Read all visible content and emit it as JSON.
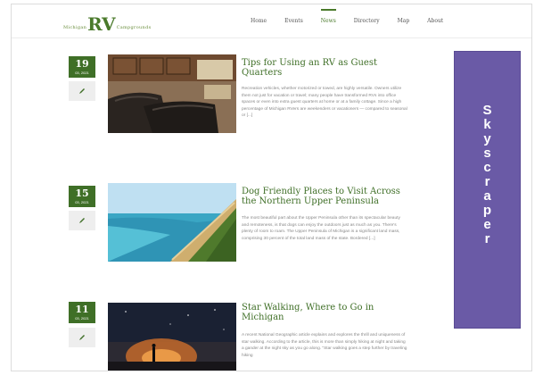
{
  "logo": {
    "left_text": "Michigan",
    "big_text": "RV",
    "right_text": "Campgrounds"
  },
  "nav": {
    "items": [
      "Home",
      "Events",
      "News",
      "Directory",
      "Map",
      "About"
    ],
    "active_index": 2
  },
  "posts": [
    {
      "day": "19",
      "month": "03, 2021",
      "title": "Tips for Using an RV as Guest Quarters",
      "excerpt": "Recreation vehicles, whether motorized or towed, are highly versatile. Owners utilize them not just for vacation or travel; many people have transformed RVs into office spaces or even into extra guest quarters at home or at a family cottage. Since a high percentage of Michigan RVers are weekenders or vacationers — compared to seasonal or [...]"
    },
    {
      "day": "15",
      "month": "03, 2021",
      "title": "Dog Friendly Places to Visit Across the Northern Upper Peninsula",
      "excerpt": "The most beautiful part about the Upper Peninsula other than its spectacular beauty and remoteness, is that dogs can enjoy the outdoors just as much as you. There's plenty of room to roam. The Upper Peninsula of Michigan is a significant land mass, comprising 30 percent of the total land mass of the state. Bordered [...]"
    },
    {
      "day": "11",
      "month": "03, 2021",
      "title": "Star Walking, Where to Go in Michigan",
      "excerpt": "A recent National Geographic article explains and explores the thrill and uniqueness of star walking. According to the article, this is more than simply hiking at night and taking a gander at the night sky as you go along. \"Star walking goes a step further by traveling hiking"
    }
  ],
  "ad": {
    "label": "Skyscraper"
  },
  "colors": {
    "brand_green": "#3f6f27",
    "ad_purple": "#6a5aa6"
  }
}
